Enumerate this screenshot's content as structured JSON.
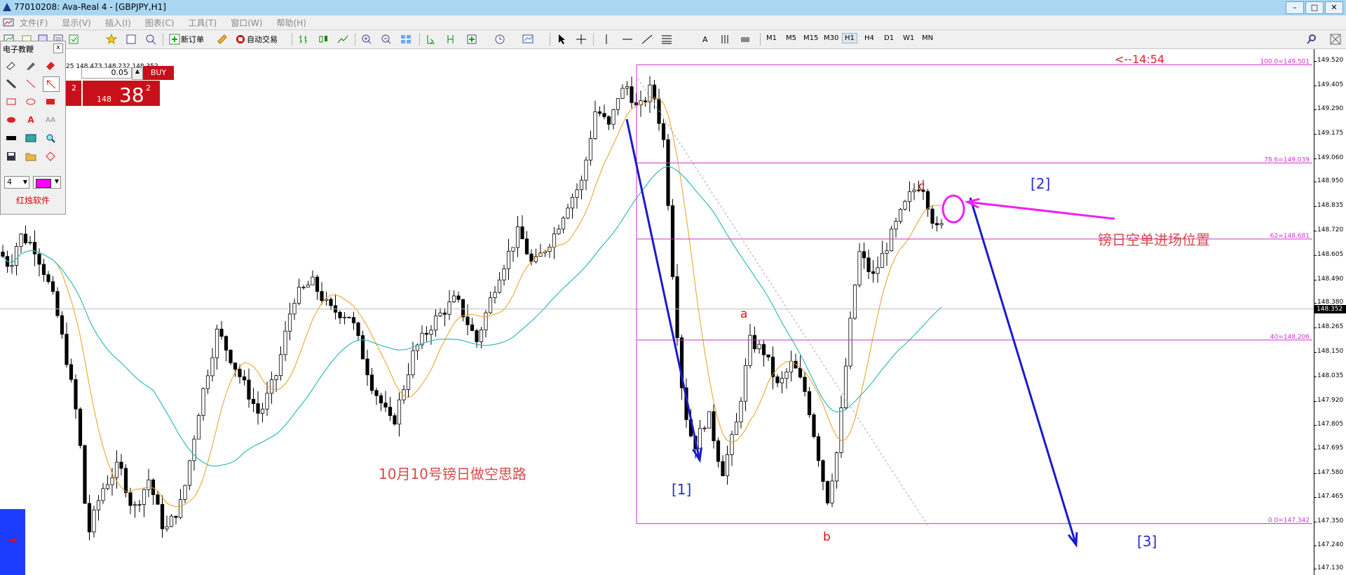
{
  "window": {
    "title": "77010208: Ava-Real 4 - [GBPJPY,H1]",
    "buttons": [
      "–",
      "□",
      "✕"
    ]
  },
  "menu": [
    "文件(F)",
    "显示(V)",
    "插入(I)",
    "图表(C)",
    "工具(T)",
    "窗口(W)",
    "帮助(H)"
  ],
  "toolbar": {
    "new_order": "新订单",
    "auto_trade": "自动交易",
    "text_tool": "A",
    "timeframes": [
      "M1",
      "M5",
      "M15",
      "M30",
      "H1",
      "H4",
      "D1",
      "W1",
      "MN"
    ],
    "active_timeframe": "H1"
  },
  "drawing_panel": {
    "title": "电子教鞭",
    "close": "x",
    "line_width": "4",
    "color": "#ff00ff",
    "footer": "红烛软件"
  },
  "trade_panel": {
    "quote": "25 148.473 148.232 148.352",
    "lot": "0.05",
    "buy_label": "BUY",
    "buy_prefix": "148",
    "buy_big": "38",
    "buy_sup": "2",
    "sell_sup": "2"
  },
  "chart": {
    "symbol": "GBPJPY",
    "timeframe": "H1",
    "timer": "<--14:54",
    "current_price": "148.352",
    "price_ticks": [
      "149.520",
      "149.405",
      "149.290",
      "149.175",
      "149.060",
      "148.950",
      "148.835",
      "148.720",
      "148.605",
      "148.490",
      "148.380",
      "148.265",
      "148.150",
      "148.035",
      "147.920",
      "147.805",
      "147.695",
      "147.580",
      "147.465",
      "147.350",
      "147.240",
      "147.130"
    ],
    "fib_levels": [
      {
        "label": "100.0=149.501",
        "price": 149.501
      },
      {
        "label": "78.6=149.039",
        "price": 149.039
      },
      {
        "label": "62=148.681",
        "price": 148.681
      },
      {
        "label": "40=148.206",
        "price": 148.206
      },
      {
        "label": "0.0=147.342",
        "price": 147.342
      }
    ],
    "annotations": {
      "title": "10月10号镑日做空思路",
      "entry": "镑日空单进场位置",
      "wave1": "[1]",
      "wave2": "[2]",
      "wave3": "[3]",
      "wave_a": "a",
      "wave_b": "b",
      "wave_c": "c"
    },
    "colors": {
      "fib": "#cc33cc",
      "arrow": "#1a1acc",
      "magenta": "#ee22ee",
      "ma_fast": "#e8a020",
      "ma_slow": "#33bbbb",
      "wave_label": "#dd1111",
      "title_text": "#d84a4a"
    }
  }
}
